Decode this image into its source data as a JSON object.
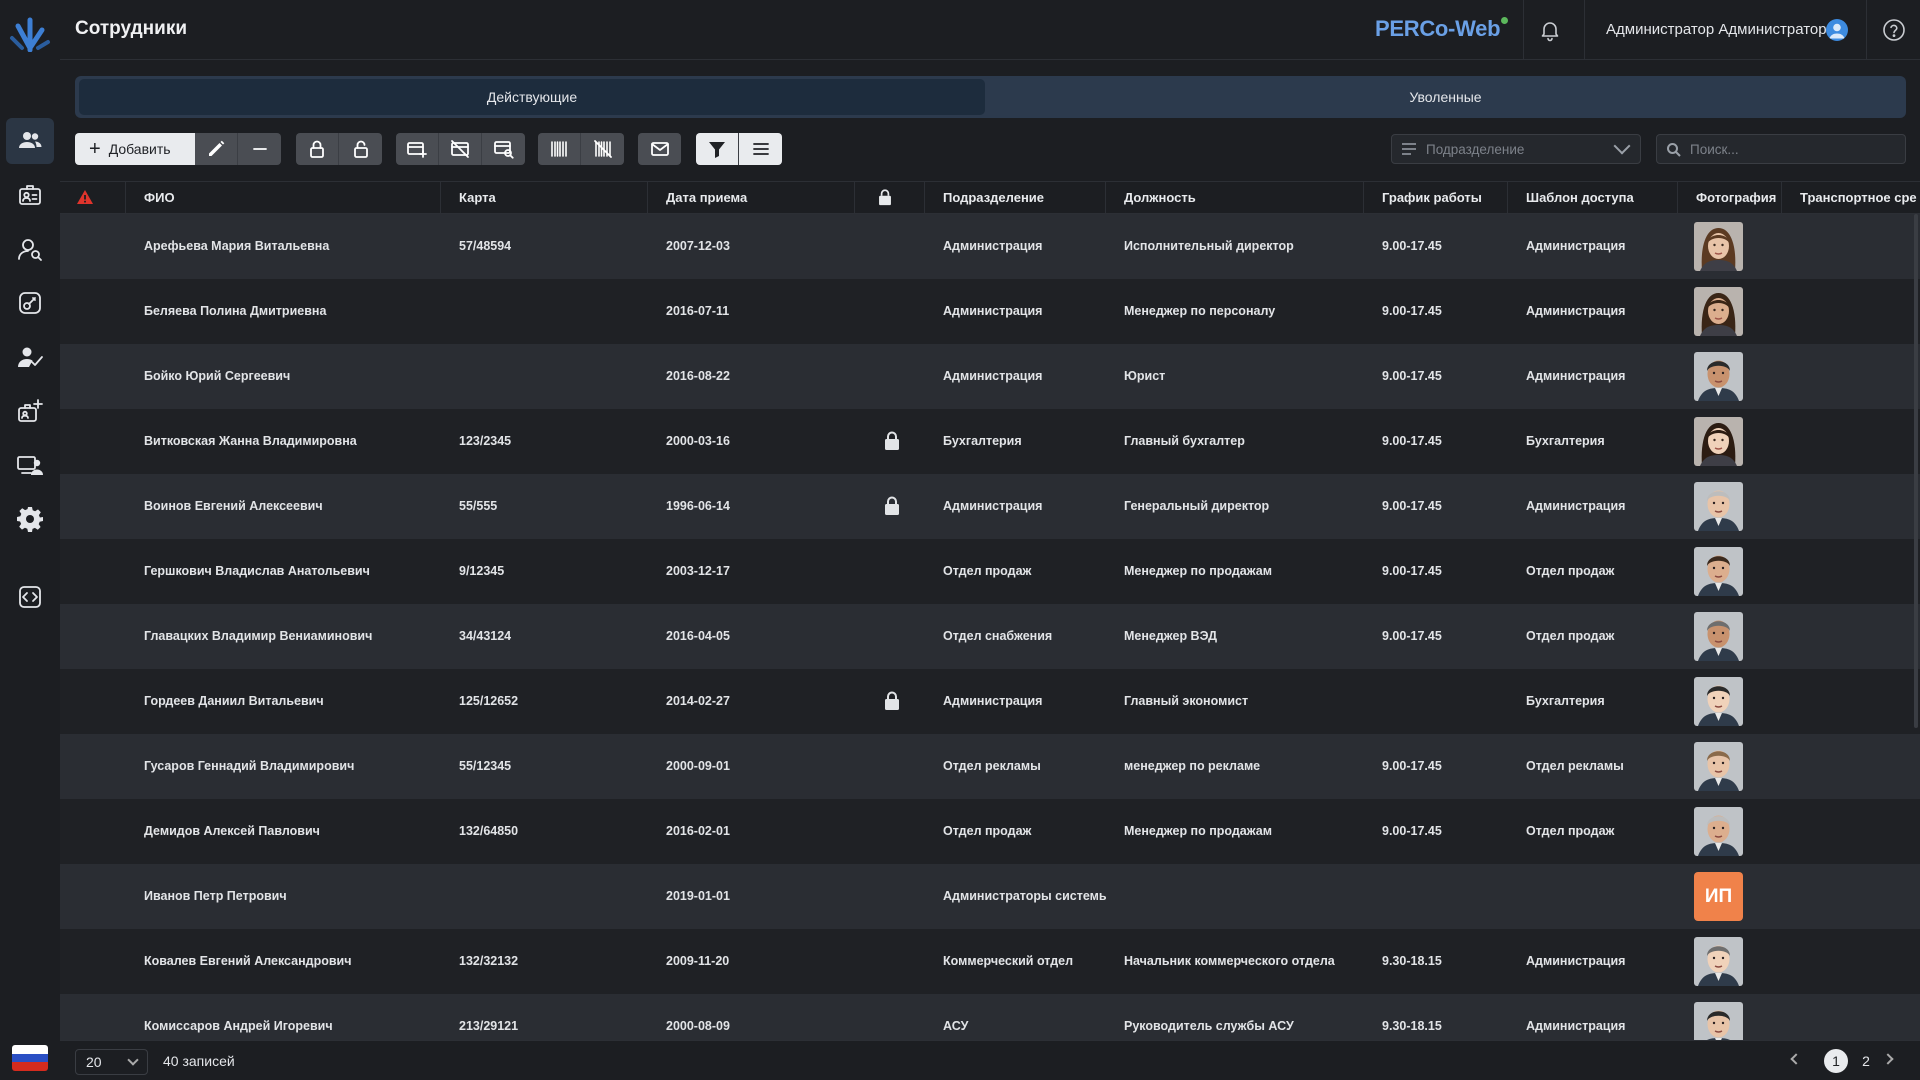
{
  "header": {
    "title": "Сотрудники",
    "brand": "PERCo-Web",
    "user_name": "Администратор Администратор"
  },
  "sidebar": {
    "items": [
      {
        "icon": "employees-icon",
        "active": true
      },
      {
        "icon": "visitors-icon",
        "active": false
      },
      {
        "icon": "monitoring-icon",
        "active": false
      },
      {
        "icon": "access-icon",
        "active": false
      },
      {
        "icon": "verification-icon",
        "active": false
      },
      {
        "icon": "add-badge-icon",
        "active": false
      },
      {
        "icon": "devices-icon",
        "active": false
      },
      {
        "icon": "settings-icon",
        "active": false
      },
      {
        "icon": "api-icon",
        "active": false
      }
    ]
  },
  "tabs": [
    {
      "label": "Действующие",
      "active": true
    },
    {
      "label": "Уволенные",
      "active": false
    }
  ],
  "toolbar": {
    "add_label": "Добавить",
    "department_placeholder": "Подразделение",
    "search_placeholder": "Поиск..."
  },
  "table": {
    "columns": [
      "ФИО",
      "Карта",
      "Дата приема",
      "Подразделение",
      "Должность",
      "График работы",
      "Шаблон доступа",
      "Фотография",
      "Транспортное сре"
    ],
    "rows": [
      {
        "name": "Арефьева Мария Витальевна",
        "card": "57/48594",
        "date": "2007-12-03",
        "locked": false,
        "dept": "Администрация",
        "position": "Исполнительный директор",
        "schedule": "9.00-17.45",
        "template": "Администрация",
        "photo": "f",
        "initials": ""
      },
      {
        "name": "Беляева Полина Дмитриевна",
        "card": "",
        "date": "2016-07-11",
        "locked": false,
        "dept": "Администрация",
        "position": "Менеджер по персоналу",
        "schedule": "9.00-17.45",
        "template": "Администрация",
        "photo": "f",
        "initials": ""
      },
      {
        "name": "Бойко Юрий Сергеевич",
        "card": "",
        "date": "2016-08-22",
        "locked": false,
        "dept": "Администрация",
        "position": "Юрист",
        "schedule": "9.00-17.45",
        "template": "Администрация",
        "photo": "m",
        "initials": ""
      },
      {
        "name": "Витковская Жанна Владимировна",
        "card": "123/2345",
        "date": "2000-03-16",
        "locked": true,
        "dept": "Бухгалтерия",
        "position": "Главный бухгалтер",
        "schedule": "9.00-17.45",
        "template": "Бухгалтерия",
        "photo": "f",
        "initials": ""
      },
      {
        "name": "Воинов Евгений Алексеевич",
        "card": "55/555",
        "date": "1996-06-14",
        "locked": true,
        "dept": "Администрация",
        "position": "Генеральный директор",
        "schedule": "9.00-17.45",
        "template": "Администрация",
        "photo": "m",
        "initials": ""
      },
      {
        "name": "Гершкович Владислав Анатольевич",
        "card": "9/12345",
        "date": "2003-12-17",
        "locked": false,
        "dept": "Отдел продаж",
        "position": "Менеджер по продажам",
        "schedule": "9.00-17.45",
        "template": "Отдел продаж",
        "photo": "m",
        "initials": ""
      },
      {
        "name": "Главацких Владимир Вениаминович",
        "card": "34/43124",
        "date": "2016-04-05",
        "locked": false,
        "dept": "Отдел снабжения",
        "position": "Менеджер ВЭД",
        "schedule": "9.00-17.45",
        "template": "Отдел продаж",
        "photo": "m",
        "initials": ""
      },
      {
        "name": "Гордеев Даниил Витальевич",
        "card": "125/12652",
        "date": "2014-02-27",
        "locked": true,
        "dept": "Администрация",
        "position": "Главный экономист",
        "schedule": "",
        "template": "Бухгалтерия",
        "photo": "m",
        "initials": ""
      },
      {
        "name": "Гусаров Геннадий Владимирович",
        "card": "55/12345",
        "date": "2000-09-01",
        "locked": false,
        "dept": "Отдел рекламы",
        "position": "менеджер по рекламе",
        "schedule": "9.00-17.45",
        "template": "Отдел рекламы",
        "photo": "m",
        "initials": ""
      },
      {
        "name": "Демидов Алексей Павлович",
        "card": "132/64850",
        "date": "2016-02-01",
        "locked": false,
        "dept": "Отдел продаж",
        "position": "Менеджер по продажам",
        "schedule": "9.00-17.45",
        "template": "Отдел продаж",
        "photo": "m",
        "initials": ""
      },
      {
        "name": "Иванов Петр Петрович",
        "card": "",
        "date": "2019-01-01",
        "locked": false,
        "dept": "Администраторы системы",
        "position": "",
        "schedule": "",
        "template": "",
        "photo": "",
        "initials": "ИП"
      },
      {
        "name": "Ковалев Евгений Александрович",
        "card": "132/32132",
        "date": "2009-11-20",
        "locked": false,
        "dept": "Коммерческий отдел",
        "position": "Начальник коммерческого отдела",
        "schedule": "9.30-18.15",
        "template": "Администрация",
        "photo": "m",
        "initials": ""
      },
      {
        "name": "Комиссаров Андрей Игоревич",
        "card": "213/29121",
        "date": "2000-08-09",
        "locked": false,
        "dept": "АСУ",
        "position": "Руководитель службы АСУ",
        "schedule": "9.30-18.15",
        "template": "Администрация",
        "photo": "m",
        "initials": ""
      }
    ]
  },
  "footer": {
    "page_size": "20",
    "records": "40 записей",
    "pages": [
      "1",
      "2"
    ],
    "current_page": "1"
  },
  "colors": {
    "accent": "#6aa0e6",
    "warning": "#e0342c",
    "initials_bg": "#f0824a"
  }
}
